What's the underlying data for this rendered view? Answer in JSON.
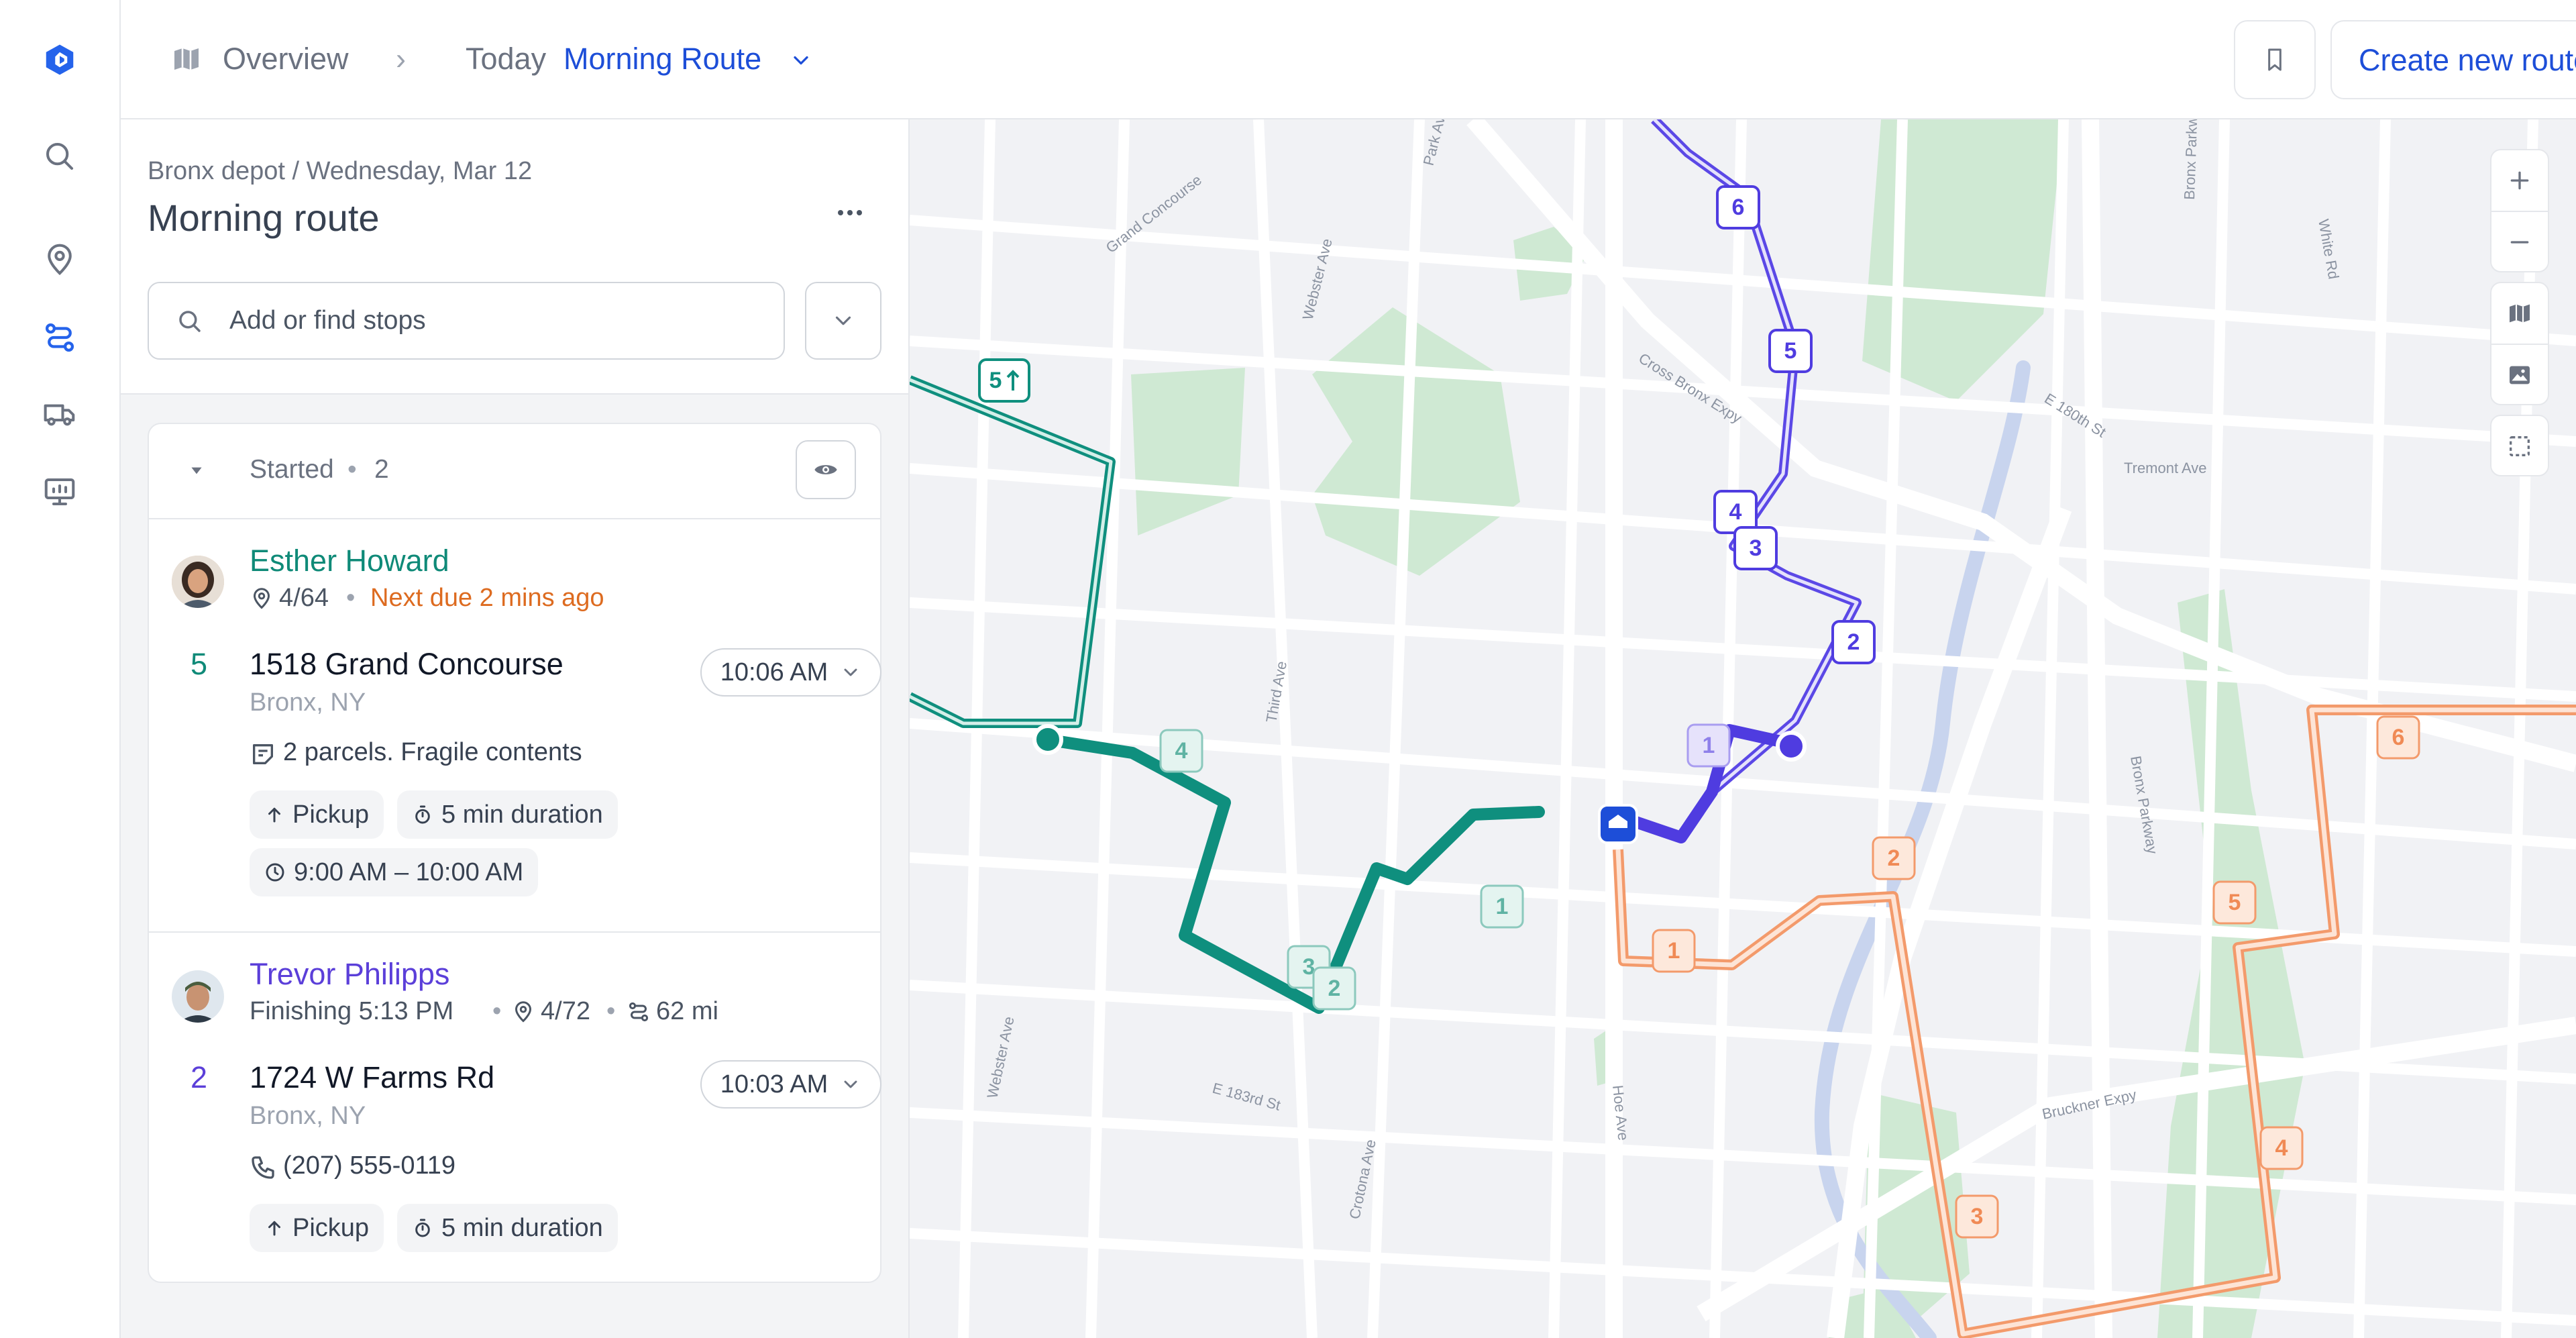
{
  "app": {
    "accent_color": "#1d4ed8",
    "rail_icons": [
      "logo-icon",
      "search-icon",
      "location-pin-icon",
      "routes-icon",
      "truck-icon",
      "dashboard-icon"
    ]
  },
  "topbar": {
    "overview_label": "Overview",
    "separator": "›",
    "today_label": "Today",
    "route_selector_label": "Morning Route",
    "create_route_label": "Create new route"
  },
  "panel": {
    "subtitle": "Bronx depot / Wednesday, Mar 12",
    "title": "Morning route",
    "search_placeholder": "Add or find stops",
    "group": {
      "label": "Started",
      "dot": "•",
      "count": "2"
    },
    "drivers": [
      {
        "name": "Esther Howard",
        "name_color": "#0f8a78",
        "stops_progress": "4/64",
        "dot": "•",
        "status": "Next due 2 mins ago",
        "status_color": "#dd6b20",
        "stop_number": "5",
        "address": "1518 Grand Concourse",
        "city": "Bronx, NY",
        "time": "10:06 AM",
        "note": "2 parcels. Fragile contents",
        "chips": [
          "Pickup",
          "5 min duration"
        ],
        "window": "9:00 AM – 10:00 AM"
      },
      {
        "name": "Trevor Philipps",
        "name_color": "#5b3fd9",
        "finishing": "Finishing 5:13 PM",
        "dot": "•",
        "stops_progress": "4/72",
        "distance": "62 mi",
        "stop_number": "2",
        "address": "1724 W Farms Rd",
        "city": "Bronx, NY",
        "time": "10:03 AM",
        "phone": "(207) 555-0119",
        "chips": [
          "Pickup",
          "5 min duration"
        ]
      }
    ]
  },
  "map": {
    "street_labels": [
      "Grand Concourse",
      "Webster Ave",
      "Park Ave",
      "Cross Bronx Expy",
      "E 180th St",
      "Tremont Ave",
      "Bronx Parkway",
      "White Rd",
      "Third Ave",
      "Webster Ave",
      "E 183rd St",
      "Crotona Ave",
      "Hoe Ave",
      "Bruckner Expy",
      "Bronx Parkway"
    ],
    "routes": [
      {
        "name": "green",
        "color": "#0f8f7e",
        "markers": [
          "5",
          "4",
          "3",
          "2",
          "1"
        ]
      },
      {
        "name": "purple",
        "color": "#4f3ce0",
        "markers": [
          "6",
          "5",
          "4",
          "3",
          "2",
          "1"
        ]
      },
      {
        "name": "orange",
        "color": "#f39a6b",
        "markers": [
          "1",
          "2",
          "3",
          "4",
          "5",
          "6"
        ]
      }
    ],
    "controls": [
      "zoom-in-icon",
      "zoom-out-icon",
      "map-view-icon",
      "satellite-view-icon",
      "fullscreen-icon"
    ]
  }
}
